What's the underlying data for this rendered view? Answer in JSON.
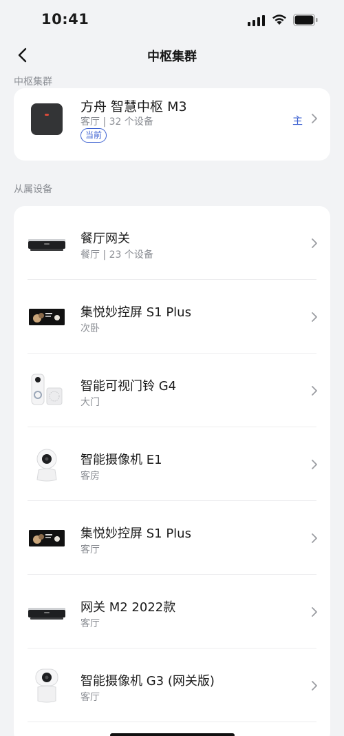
{
  "status": {
    "time": "10:41"
  },
  "nav": {
    "title": "中枢集群"
  },
  "sections": {
    "hub_label": "中枢集群",
    "devices_label": "从属设备"
  },
  "hub": {
    "name": "方舟 智慧中枢 M3",
    "subtitle": "客厅 | 32 个设备",
    "current_badge": "当前",
    "role_badge": "主",
    "icon": "hub-m3"
  },
  "devices": [
    {
      "name": "餐厅网关",
      "room": "餐厅 | 23 个设备",
      "icon": "gateway"
    },
    {
      "name": "集悦妙控屏 S1 Plus",
      "room": "次卧",
      "icon": "control-screen"
    },
    {
      "name": "智能可视门铃 G4",
      "room": "大门",
      "icon": "doorbell"
    },
    {
      "name": "智能摄像机 E1",
      "room": "客房",
      "icon": "camera"
    },
    {
      "name": "集悦妙控屏 S1 Plus",
      "room": "客厅",
      "icon": "control-screen"
    },
    {
      "name": "网关 M2 2022款",
      "room": "客厅",
      "icon": "gateway"
    },
    {
      "name": "智能摄像机 G3 (网关版)",
      "room": "客厅",
      "icon": "camera-g3"
    }
  ],
  "colors": {
    "accent": "#3a5fd0",
    "background": "#f2f3f5",
    "card": "#ffffff"
  }
}
